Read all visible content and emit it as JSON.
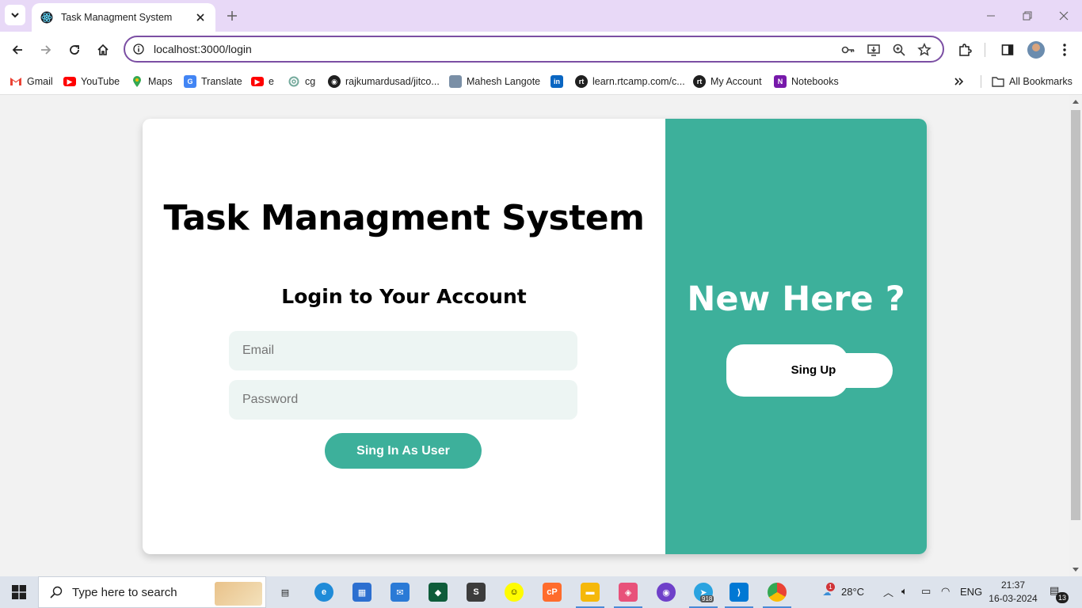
{
  "browser": {
    "tab_title": "Task Managment System",
    "url": "localhost:3000/login",
    "bookmarks": [
      {
        "label": "Gmail",
        "icon": "gmail-icon",
        "color": "#ea4335"
      },
      {
        "label": "YouTube",
        "icon": "youtube-icon",
        "color": "#ff0000"
      },
      {
        "label": "Maps",
        "icon": "maps-icon",
        "color": "#34a853"
      },
      {
        "label": "Translate",
        "icon": "translate-icon",
        "color": "#4285f4"
      },
      {
        "label": "e",
        "icon": "youtube-icon",
        "color": "#ff0000"
      },
      {
        "label": "cg",
        "icon": "chatgpt-icon",
        "color": "#74aa9c"
      },
      {
        "label": "rajkumardusad/jitco...",
        "icon": "github-icon",
        "color": "#1f1f1f"
      },
      {
        "label": "Mahesh Langote",
        "icon": "profile-photo-icon",
        "color": "#7a8fa6"
      },
      {
        "label": "",
        "icon": "linkedin-icon",
        "color": "#0a66c2"
      },
      {
        "label": "learn.rtcamp.com/c...",
        "icon": "rtcamp-icon",
        "color": "#1f1f1f"
      },
      {
        "label": "My Account",
        "icon": "rtcamp-icon",
        "color": "#1f1f1f"
      },
      {
        "label": "Notebooks",
        "icon": "onenote-icon",
        "color": "#7719aa"
      }
    ],
    "all_bookmarks_label": "All Bookmarks"
  },
  "page": {
    "app_title": "Task Managment System",
    "login_heading": "Login to Your Account",
    "email_placeholder": "Email",
    "password_placeholder": "Password",
    "signin_label": "Sing In As User",
    "new_here": "New Here ?",
    "signup_label": "Sing Up",
    "accent_color": "#3db09b"
  },
  "taskbar": {
    "search_placeholder": "Type here to search",
    "weather": "28°C",
    "weather_badge": "1",
    "language": "ENG",
    "time": "21:37",
    "date": "16-03-2024",
    "notifications": "13",
    "telegram_badge": "918"
  }
}
